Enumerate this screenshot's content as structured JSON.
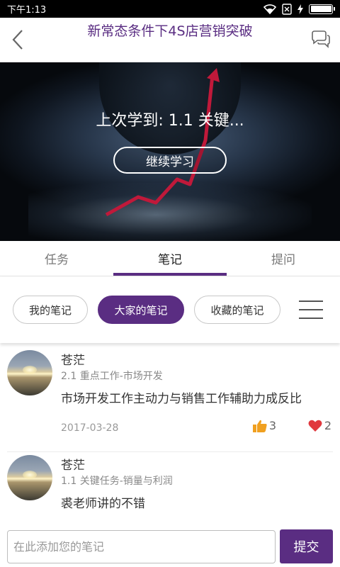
{
  "status_bar": {
    "time": "下午1:13",
    "icons": [
      "wifi-icon",
      "sim-x-icon",
      "charging-icon",
      "battery-icon"
    ],
    "battery_level": 1.0
  },
  "header": {
    "title": "新常态条件下4S店营销突破",
    "back_icon": "chevron-left-icon",
    "chat_icon": "chat-bubbles-icon"
  },
  "banner": {
    "last_learned": "上次学到: 1.1 关键...",
    "continue_label": "继续学习"
  },
  "tabs": [
    {
      "label": "任务",
      "active": false
    },
    {
      "label": "笔记",
      "active": true
    },
    {
      "label": "提问",
      "active": false
    }
  ],
  "filters": [
    {
      "label": "我的笔记",
      "active": false
    },
    {
      "label": "大家的笔记",
      "active": true
    },
    {
      "label": "收藏的笔记",
      "active": false
    }
  ],
  "notes": [
    {
      "user": "苍茫",
      "chapter": "2.1 重点工作-市场开发",
      "content": "市场开发工作主动力与销售工作辅助力成反比",
      "date": "2017-03-28",
      "likes": "3",
      "favorites": "2"
    },
    {
      "user": "苍茫",
      "chapter": "1.1 关键任务-销量与利润",
      "content": "裘老师讲的不错",
      "date": "",
      "likes": "",
      "favorites": ""
    }
  ],
  "input": {
    "placeholder": "在此添加您的笔记",
    "value": "",
    "submit_label": "提交"
  },
  "colors": {
    "accent": "#5a2d82",
    "like": "#f0a020",
    "favorite": "#e0383e"
  }
}
